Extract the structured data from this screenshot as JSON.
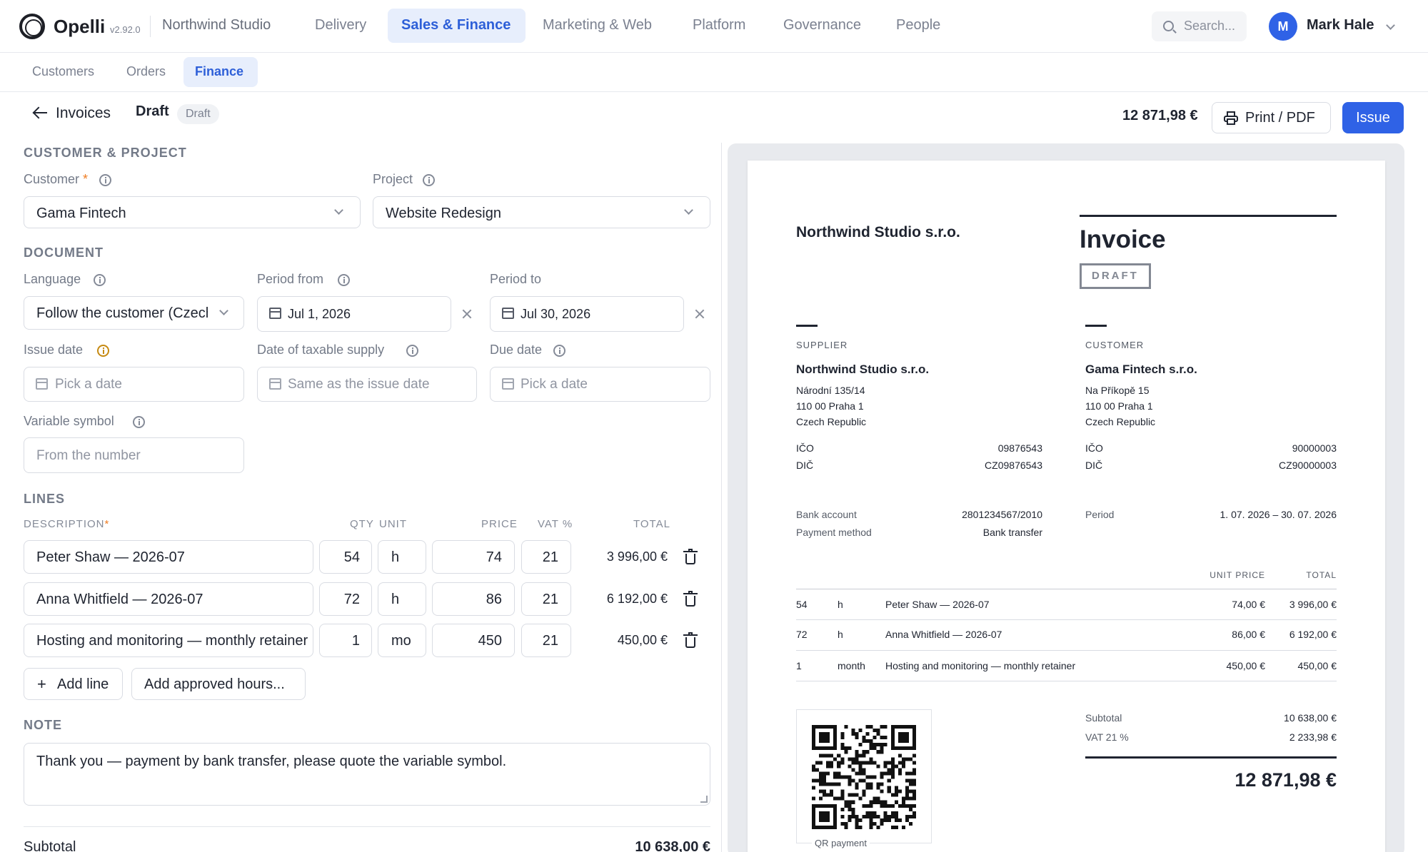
{
  "topbar": {
    "brand": "Opelli",
    "version": "v2.92.0",
    "org": "Northwind Studio",
    "nav": [
      "Delivery",
      "Sales & Finance",
      "Marketing & Web",
      "Platform",
      "Governance",
      "People"
    ],
    "search_placeholder": "Search...",
    "avatar_initial": "M",
    "user_name": "Mark Hale"
  },
  "subnav": [
    "Customers",
    "Orders",
    "Finance"
  ],
  "header": {
    "back_label": "Invoices",
    "title": "Draft",
    "status": "Draft",
    "total": "12 871,98 €",
    "print_label": "Print / PDF",
    "issue_label": "Issue"
  },
  "form": {
    "section_customer": "CUSTOMER & PROJECT",
    "customer_label": "Customer",
    "customer_required": "*",
    "customer_value": "Gama Fintech",
    "project_label": "Project",
    "project_value": "Website Redesign",
    "section_document": "DOCUMENT",
    "language_label": "Language",
    "language_value": "Follow the customer (Czech)",
    "period_from_label": "Period from",
    "period_from_value": "Jul 1, 2026",
    "period_to_label": "Period to",
    "period_to_value": "Jul 30, 2026",
    "issue_date_label": "Issue date",
    "issue_date_placeholder": "Pick a date",
    "taxable_label": "Date of taxable supply",
    "taxable_placeholder": "Same as the issue date",
    "due_label": "Due date",
    "due_placeholder": "Pick a date",
    "variable_label": "Variable symbol",
    "variable_placeholder": "From the number",
    "section_lines": "LINES",
    "col_description": "DESCRIPTION",
    "col_description_required": "*",
    "col_qty": "QTY",
    "col_unit": "UNIT",
    "col_price": "PRICE",
    "col_vat": "VAT %",
    "col_total": "TOTAL",
    "lines": [
      {
        "description": "Peter Shaw — 2026-07",
        "qty": "54",
        "unit": "h",
        "price": "74",
        "vat": "21",
        "total": "3 996,00 €"
      },
      {
        "description": "Anna Whitfield — 2026-07",
        "qty": "72",
        "unit": "h",
        "price": "86",
        "vat": "21",
        "total": "6 192,00 €"
      },
      {
        "description": "Hosting and monitoring — monthly retainer",
        "qty": "1",
        "unit": "mo",
        "price": "450",
        "vat": "21",
        "total": "450,00 €"
      }
    ],
    "add_line": "Add line",
    "add_hours": "Add approved hours...",
    "section_note": "NOTE",
    "note": "Thank you — payment by bank transfer, please quote the variable symbol.",
    "subtotal_label": "Subtotal",
    "subtotal_value": "10 638,00 €"
  },
  "preview": {
    "supplier_name_top": "Northwind Studio s.r.o.",
    "title": "Invoice",
    "stamp": "DRAFT",
    "supplier_heading": "SUPPLIER",
    "supplier_name": "Northwind Studio s.r.o.",
    "supplier_address": [
      "Národní 135/14",
      "110 00 Praha 1",
      "Czech Republic"
    ],
    "supplier_ico_label": "IČO",
    "supplier_ico": "09876543",
    "supplier_dic_label": "DIČ",
    "supplier_dic": "CZ09876543",
    "customer_heading": "CUSTOMER",
    "customer_name": "Gama Fintech s.r.o.",
    "customer_address": [
      "Na Příkopě 15",
      "110 00 Praha 1",
      "Czech Republic"
    ],
    "customer_ico_label": "IČO",
    "customer_ico": "90000003",
    "customer_dic_label": "DIČ",
    "customer_dic": "CZ90000003",
    "bank_label": "Bank account",
    "bank_value": "2801234567/2010",
    "payment_label": "Payment method",
    "payment_value": "Bank transfer",
    "period_label": "Period",
    "period_value": "1. 07. 2026 – 30. 07. 2026",
    "col_unit_price": "UNIT PRICE",
    "col_total": "TOTAL",
    "lines": [
      {
        "qty": "54",
        "unit": "h",
        "description": "Peter Shaw — 2026-07",
        "unit_price": "74,00 €",
        "total": "3 996,00 €"
      },
      {
        "qty": "72",
        "unit": "h",
        "description": "Anna Whitfield — 2026-07",
        "unit_price": "86,00 €",
        "total": "6 192,00 €"
      },
      {
        "qty": "1",
        "unit": "month",
        "description": "Hosting and monitoring — monthly retainer",
        "unit_price": "450,00 €",
        "total": "450,00 €"
      }
    ],
    "qr_label": "QR payment",
    "subtotal_label": "Subtotal",
    "subtotal_value": "10 638,00 €",
    "vat_label": "VAT 21 %",
    "vat_value": "2 233,98 €",
    "grand_total": "12 871,98 €"
  }
}
